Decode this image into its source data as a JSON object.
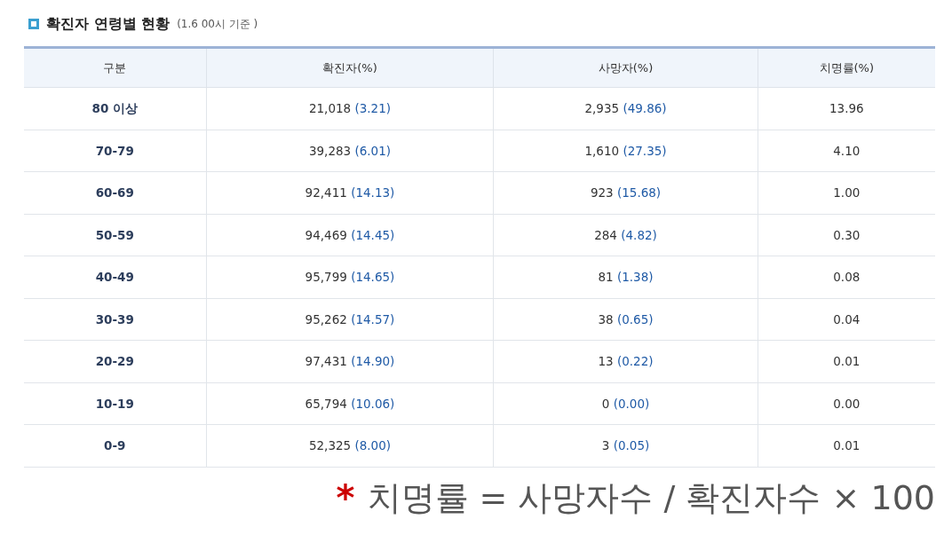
{
  "section": {
    "title": "확진자 연령별 현황",
    "note": "(1.6 00시 기준 )"
  },
  "table": {
    "columns": [
      "구분",
      "확진자(%)",
      "사망자(%)",
      "치명률(%)"
    ],
    "rows": [
      {
        "group": "80 이상",
        "confirmed": {
          "count": "21,018",
          "share": "(3.21)"
        },
        "deaths": {
          "count": "2,935",
          "share": "(49.86)"
        },
        "fatality": "13.96"
      },
      {
        "group": "70-79",
        "confirmed": {
          "count": "39,283",
          "share": "(6.01)"
        },
        "deaths": {
          "count": "1,610",
          "share": "(27.35)"
        },
        "fatality": "4.10"
      },
      {
        "group": "60-69",
        "confirmed": {
          "count": "92,411",
          "share": "(14.13)"
        },
        "deaths": {
          "count": "923",
          "share": "(15.68)"
        },
        "fatality": "1.00"
      },
      {
        "group": "50-59",
        "confirmed": {
          "count": "94,469",
          "share": "(14.45)"
        },
        "deaths": {
          "count": "284",
          "share": "(4.82)"
        },
        "fatality": "0.30"
      },
      {
        "group": "40-49",
        "confirmed": {
          "count": "95,799",
          "share": "(14.65)"
        },
        "deaths": {
          "count": "81",
          "share": "(1.38)"
        },
        "fatality": "0.08"
      },
      {
        "group": "30-39",
        "confirmed": {
          "count": "95,262",
          "share": "(14.57)"
        },
        "deaths": {
          "count": "38",
          "share": "(0.65)"
        },
        "fatality": "0.04"
      },
      {
        "group": "20-29",
        "confirmed": {
          "count": "97,431",
          "share": "(14.90)"
        },
        "deaths": {
          "count": "13",
          "share": "(0.22)"
        },
        "fatality": "0.01"
      },
      {
        "group": "10-19",
        "confirmed": {
          "count": "65,794",
          "share": "(10.06)"
        },
        "deaths": {
          "count": "0",
          "share": "(0.00)"
        },
        "fatality": "0.00"
      },
      {
        "group": "0-9",
        "confirmed": {
          "count": "52,325",
          "share": "(8.00)"
        },
        "deaths": {
          "count": "3",
          "share": "(0.05)"
        },
        "fatality": "0.01"
      }
    ]
  },
  "footnote": {
    "mark": "*",
    "text": "치명률 = 사망자수 / 확진자수 × 100"
  }
}
